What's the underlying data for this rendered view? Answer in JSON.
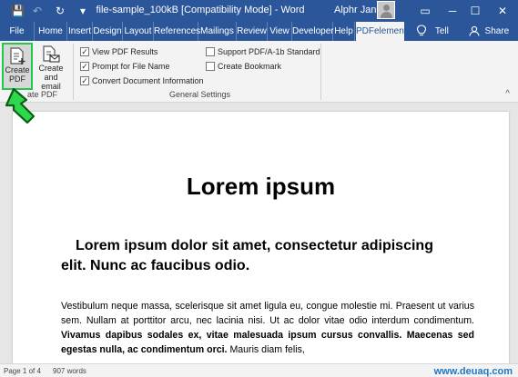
{
  "titlebar": {
    "title": "file-sample_100kB [Compatibility Mode]  -  Word",
    "user": "Alphr Jan",
    "save_icon": "💾",
    "undo_icon": "↶",
    "redo_icon": "↻",
    "more_icon": "▾",
    "ribbon_display_icon": "▭",
    "minimize_icon": "─",
    "maximize_icon": "☐",
    "close_icon": "✕",
    "accent_color": "#2b579a"
  },
  "tabs": [
    "File",
    "Home",
    "Insert",
    "Design",
    "Layout",
    "References",
    "Mailings",
    "Review",
    "View",
    "Developer",
    "Help",
    "PDFelement"
  ],
  "tell_me": "Tell me",
  "share": "Share",
  "ribbon": {
    "create_pdf": [
      "Create",
      "PDF"
    ],
    "create_email": [
      "Create",
      "and email"
    ],
    "group_create": "ate PDF",
    "checks": [
      {
        "label": "View PDF Results",
        "checked": true
      },
      {
        "label": "Prompt for File Name",
        "checked": true
      },
      {
        "label": "Convert Document Information",
        "checked": true
      },
      {
        "label": "Support PDF/A-1b Standard",
        "checked": false
      },
      {
        "label": "Create Bookmark",
        "checked": false
      }
    ],
    "group_settings": "General Settings",
    "collapse_icon": "^"
  },
  "document": {
    "heading1": "Lorem ipsum",
    "heading2": "Lorem ipsum dolor sit amet, consectetur adipiscing elit. Nunc ac faucibus odio.",
    "para_start": "Vestibulum neque massa, scelerisque sit amet ligula eu, congue molestie mi. Praesent ut varius sem. Nullam at porttitor arcu, nec lacinia nisi. Ut ac dolor vitae odio interdum condimentum. ",
    "para_bold": "Vivamus dapibus sodales ex, vitae malesuada ipsum cursus convallis. Maecenas sed egestas nulla, ac condimentum orci.",
    "para_end": " Mauris diam felis,"
  },
  "status": {
    "page": "Page 1 of 4",
    "words": "907 words",
    "watermark": "www.deuaq.com"
  }
}
